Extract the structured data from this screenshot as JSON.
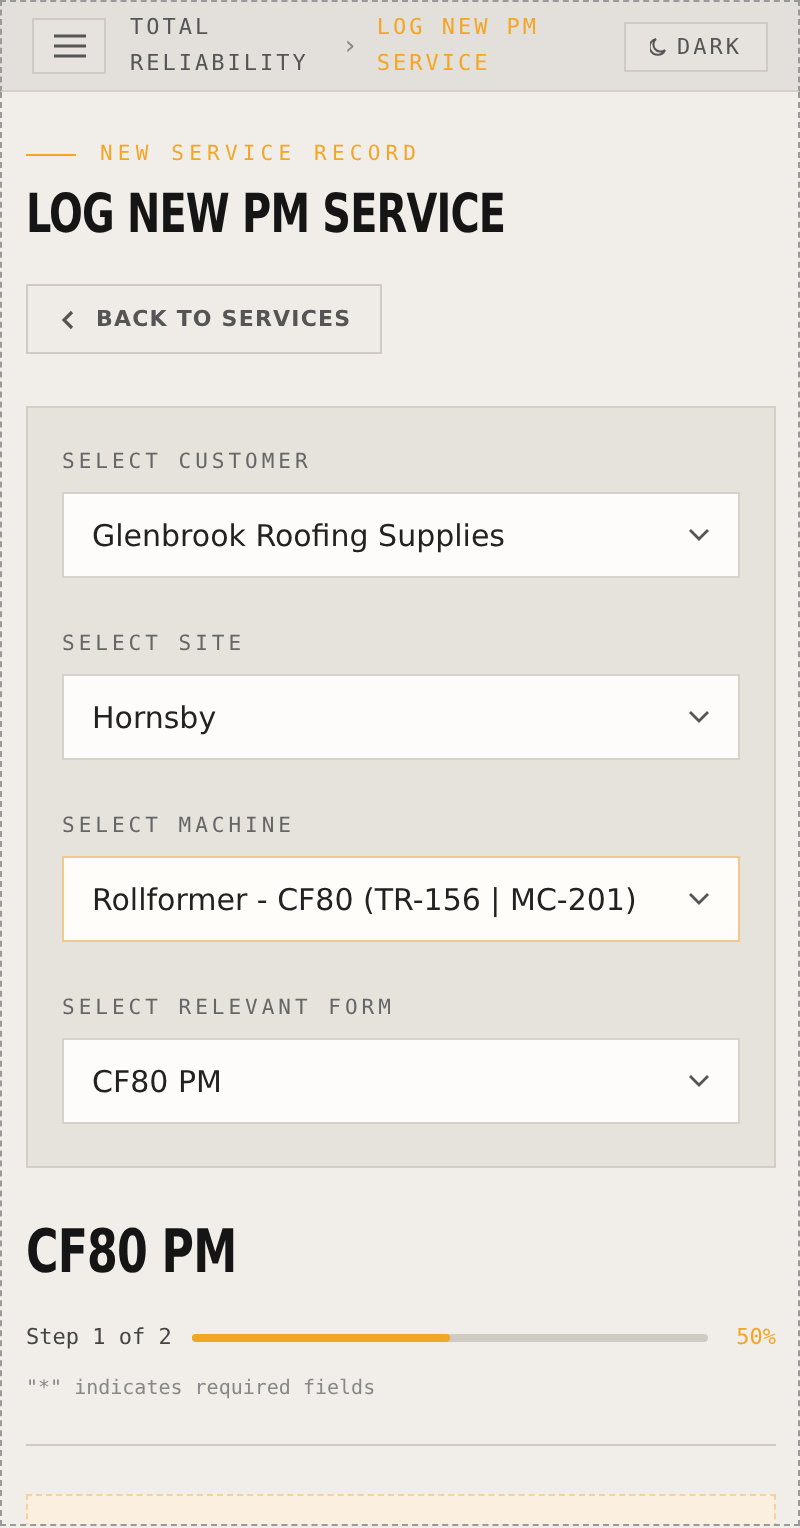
{
  "header": {
    "brand": "TOTAL RELIABILITY",
    "breadcrumb_separator": "›",
    "current_page": "LOG NEW PM SERVICE",
    "theme_button": "DARK"
  },
  "eyebrow": "NEW SERVICE RECORD",
  "title": "LOG NEW PM SERVICE",
  "back_button": "BACK TO SERVICES",
  "selects": [
    {
      "label": "SELECT CUSTOMER",
      "value": "Glenbrook Roofing Supplies",
      "focused": false
    },
    {
      "label": "SELECT SITE",
      "value": "Hornsby",
      "focused": false
    },
    {
      "label": "SELECT MACHINE",
      "value": "Rollformer - CF80 (TR-156 | MC-201)",
      "focused": true
    },
    {
      "label": "SELECT RELEVANT FORM",
      "value": "CF80 PM",
      "focused": false
    }
  ],
  "form": {
    "title": "CF80 PM",
    "step": "Step 1 of 2",
    "level": 0.5,
    "percent": "50%",
    "required_note": "\"*\" indicates required fields"
  }
}
